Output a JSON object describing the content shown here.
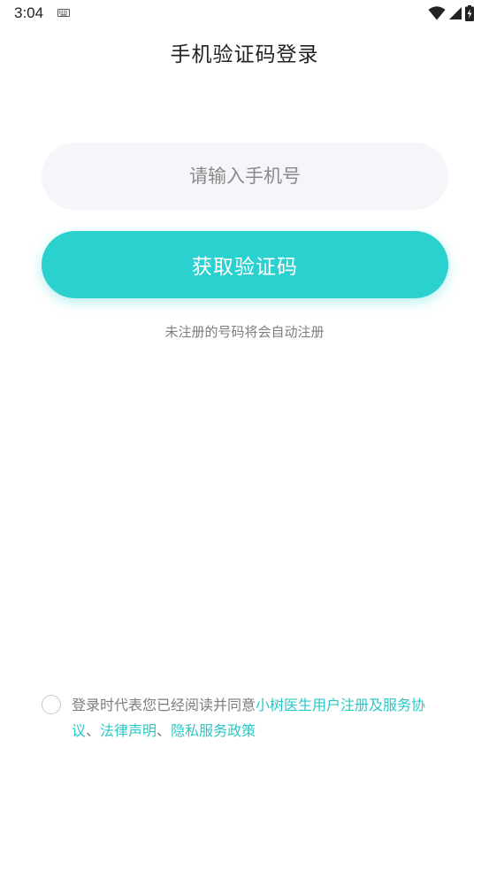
{
  "status_bar": {
    "time": "3:04",
    "icons": [
      "keyboard-icon",
      "wifi-icon",
      "signal-icon",
      "battery-charging-icon"
    ]
  },
  "page": {
    "title": "手机验证码登录"
  },
  "login_form": {
    "phone_placeholder": "请输入手机号",
    "phone_value": "",
    "get_code_label": "获取验证码",
    "hint": "未注册的号码将会自动注册"
  },
  "agreement": {
    "checked": false,
    "prefix": "登录时代表您已经阅读并同意",
    "user_agreement_link": "小树医生用户注册及服务协议",
    "separator_1": "、",
    "legal_link": "法律声明",
    "separator_2": "、",
    "privacy_link": "隐私服务政策"
  },
  "colors": {
    "accent": "#2ad1cf",
    "link": "#2ac8c6",
    "input_background": "#f5f6fa",
    "hint_text": "#7d7d7d"
  }
}
